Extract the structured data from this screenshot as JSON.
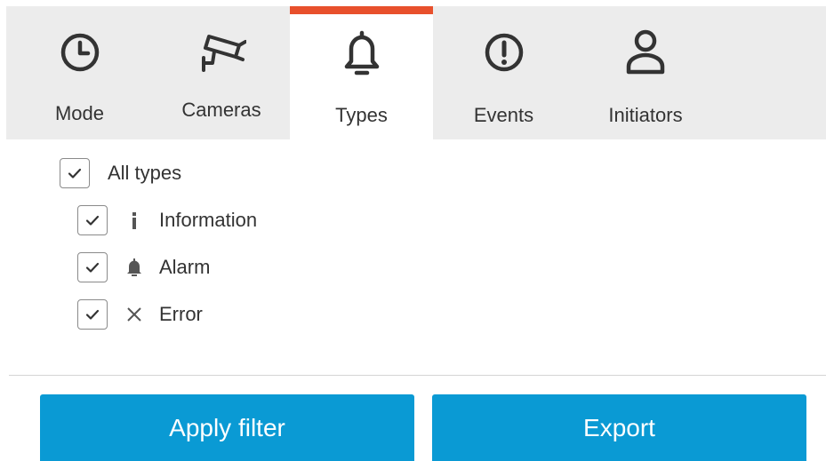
{
  "tabs": [
    {
      "label": "Mode",
      "icon": "clock-icon"
    },
    {
      "label": "Cameras",
      "icon": "camera-icon"
    },
    {
      "label": "Types",
      "icon": "bell-icon"
    },
    {
      "label": "Events",
      "icon": "exclamation-circle-icon"
    },
    {
      "label": "Initiators",
      "icon": "user-icon"
    }
  ],
  "active_tab": "Types",
  "accent_color": "#e8502c",
  "types": {
    "all": {
      "label": "All types",
      "checked": true
    },
    "items": [
      {
        "label": "Information",
        "icon": "info-icon",
        "checked": true
      },
      {
        "label": "Alarm",
        "icon": "bell-icon",
        "checked": true
      },
      {
        "label": "Error",
        "icon": "close-icon",
        "checked": true
      }
    ]
  },
  "buttons": {
    "apply_label": "Apply filter",
    "export_label": "Export",
    "color": "#0a9ad4"
  }
}
